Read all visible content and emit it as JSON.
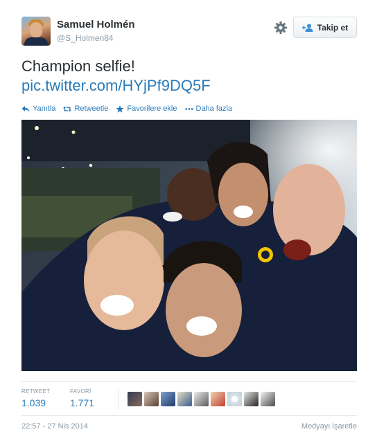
{
  "user": {
    "name": "Samuel Holmén",
    "handle": "@S_Holmen84",
    "follow_label": "Takip et"
  },
  "tweet": {
    "text": "Champion selfie!",
    "link": "pic.twitter.com/HYjPf9DQ5F"
  },
  "actions": [
    {
      "label": "Yanıtla",
      "icon": "reply-icon"
    },
    {
      "label": "Retweetle",
      "icon": "retweet-icon"
    },
    {
      "label": "Favorilere ekle",
      "icon": "star-icon"
    },
    {
      "label": "Daha fazla",
      "icon": "more-icon"
    }
  ],
  "stats": {
    "retweet_label": "RETWEET",
    "retweet_count": "1.039",
    "favori_label": "FAVORİ",
    "favori_count": "1.771"
  },
  "footer": {
    "timestamp": "22:57 - 27 Nis 2014",
    "flag_media": "Medyayı işaretle"
  },
  "colors": {
    "link": "#2b7bb9",
    "muted": "#8899a6",
    "text": "#292f33"
  }
}
